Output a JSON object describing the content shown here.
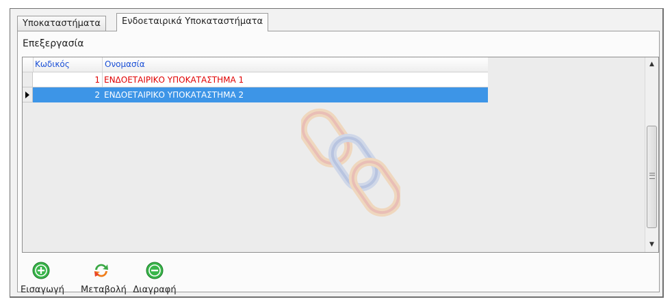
{
  "tabs": [
    {
      "label": "Υποκαταστήματα",
      "active": false
    },
    {
      "label": "Ενδοεταιρικά Υποκαταστήματα",
      "active": true
    }
  ],
  "panel": {
    "title": "Επεξεργασία"
  },
  "grid": {
    "columns": [
      "Κωδικός",
      "Ονομασία"
    ],
    "rows": [
      {
        "code": "1",
        "name": "ΕΝΔΟΕΤΑΙΡΙΚΟ ΥΠΟΚΑΤΑΣΤΗΜΑ 1",
        "color": "#e00000",
        "selected": false
      },
      {
        "code": "2",
        "name": "ΕΝΔΟΕΤΑΙΡΙΚΟ ΥΠΟΚΑΤΑΣΤΗΜΑ 2",
        "color": "#ffffff",
        "selected": true
      }
    ],
    "selection_color": "#3d95e7",
    "header_text_color": "#1a4fd6"
  },
  "toolbar": {
    "insert_label": "Εισαγωγή",
    "modify_label": "Μεταβολή",
    "delete_label": "Διαγραφή",
    "insert_icon": "plus-circle-icon",
    "modify_icon": "refresh-arrows-icon",
    "delete_icon": "minus-circle-icon"
  }
}
